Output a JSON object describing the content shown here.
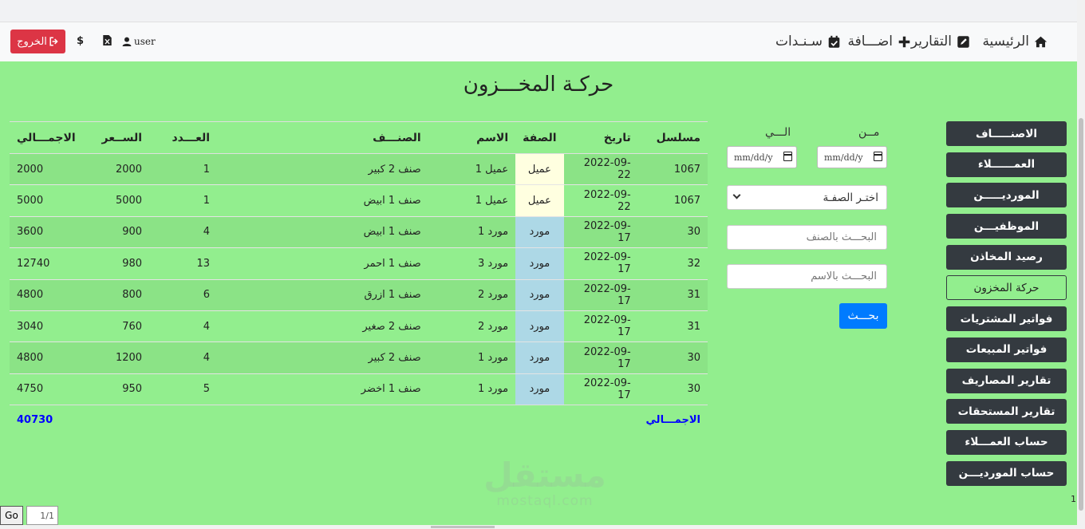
{
  "navbar": {
    "items": [
      {
        "label": "الرئيسية",
        "icon": "home-icon"
      },
      {
        "label": "التقارير",
        "icon": "report-icon"
      },
      {
        "label": "اضـــافة",
        "icon": "plus-icon"
      },
      {
        "label": "سـنـدات",
        "icon": "calendar-check-icon"
      }
    ],
    "user": "user",
    "logout": "الخروج"
  },
  "page_title": "حركـة المخـــزون",
  "sidebar": {
    "items": [
      "الاصنـــــاف",
      "العمــــــلاء",
      "الموردیـــــن",
      "الموظفیـــن",
      "رصيد المخاذن",
      "حركة المخزون",
      "فواتير المشتريات",
      "فواتير المبيعات",
      "تقارير المصاريف",
      "تقارير المستحقات",
      "حساب العمـــلاء",
      "حساب الموردیـــن"
    ],
    "active_index": 5,
    "marker": "1"
  },
  "filters": {
    "from_label": "مــن",
    "to_label": "الـــي",
    "date_placeholder": "mm/dd/y",
    "type_select": "اختـر الصفـة",
    "search_item_placeholder": "البحـــث بالصنف",
    "search_name_placeholder": "البحـــث بالاسم",
    "search_button": "بحـــث"
  },
  "table": {
    "headers": [
      "مسلسل",
      "تاريخ",
      "الصفة",
      "الاسم",
      "الصنـــف",
      "العـــدد",
      "الســعر",
      "الاجمـــالي"
    ],
    "rows": [
      [
        "1067",
        "2022-09-22",
        "عميل",
        "عميل 1",
        "صنف 2 كبير",
        "1",
        "2000",
        "2000"
      ],
      [
        "1067",
        "2022-09-22",
        "عميل",
        "عميل 1",
        "صنف 1 ابيض",
        "1",
        "5000",
        "5000"
      ],
      [
        "30",
        "2022-09-17",
        "مورد",
        "مورد 1",
        "صنف 1 ابيض",
        "4",
        "900",
        "3600"
      ],
      [
        "32",
        "2022-09-17",
        "مورد",
        "مورد 3",
        "صنف 1 احمر",
        "13",
        "980",
        "12740"
      ],
      [
        "31",
        "2022-09-17",
        "مورد",
        "مورد 2",
        "صنف 1 ازرق",
        "6",
        "800",
        "4800"
      ],
      [
        "31",
        "2022-09-17",
        "مورد",
        "مورد 2",
        "صنف 2 صغير",
        "4",
        "760",
        "3040"
      ],
      [
        "30",
        "2022-09-17",
        "مورد",
        "مورد 1",
        "صنف 2 كبير",
        "4",
        "1200",
        "4800"
      ],
      [
        "30",
        "2022-09-17",
        "مورد",
        "مورد 1",
        "صنف 1 اخضر",
        "5",
        "950",
        "4750"
      ]
    ],
    "total_label": "الاجمـــالي",
    "total_value": "40730"
  },
  "watermark": {
    "arabic": "مستقل",
    "latin": "mostaql.com"
  },
  "pager": {
    "go": "Go",
    "page": "1/1"
  },
  "colors": {
    "content_bg": "#92ee8e",
    "sidebar_btn": "#343a40",
    "logout": "#dc3545",
    "search": "#007bff",
    "client_cell": "#ffffe0",
    "supplier_cell": "#add8e6",
    "total_text": "#0000ff"
  }
}
